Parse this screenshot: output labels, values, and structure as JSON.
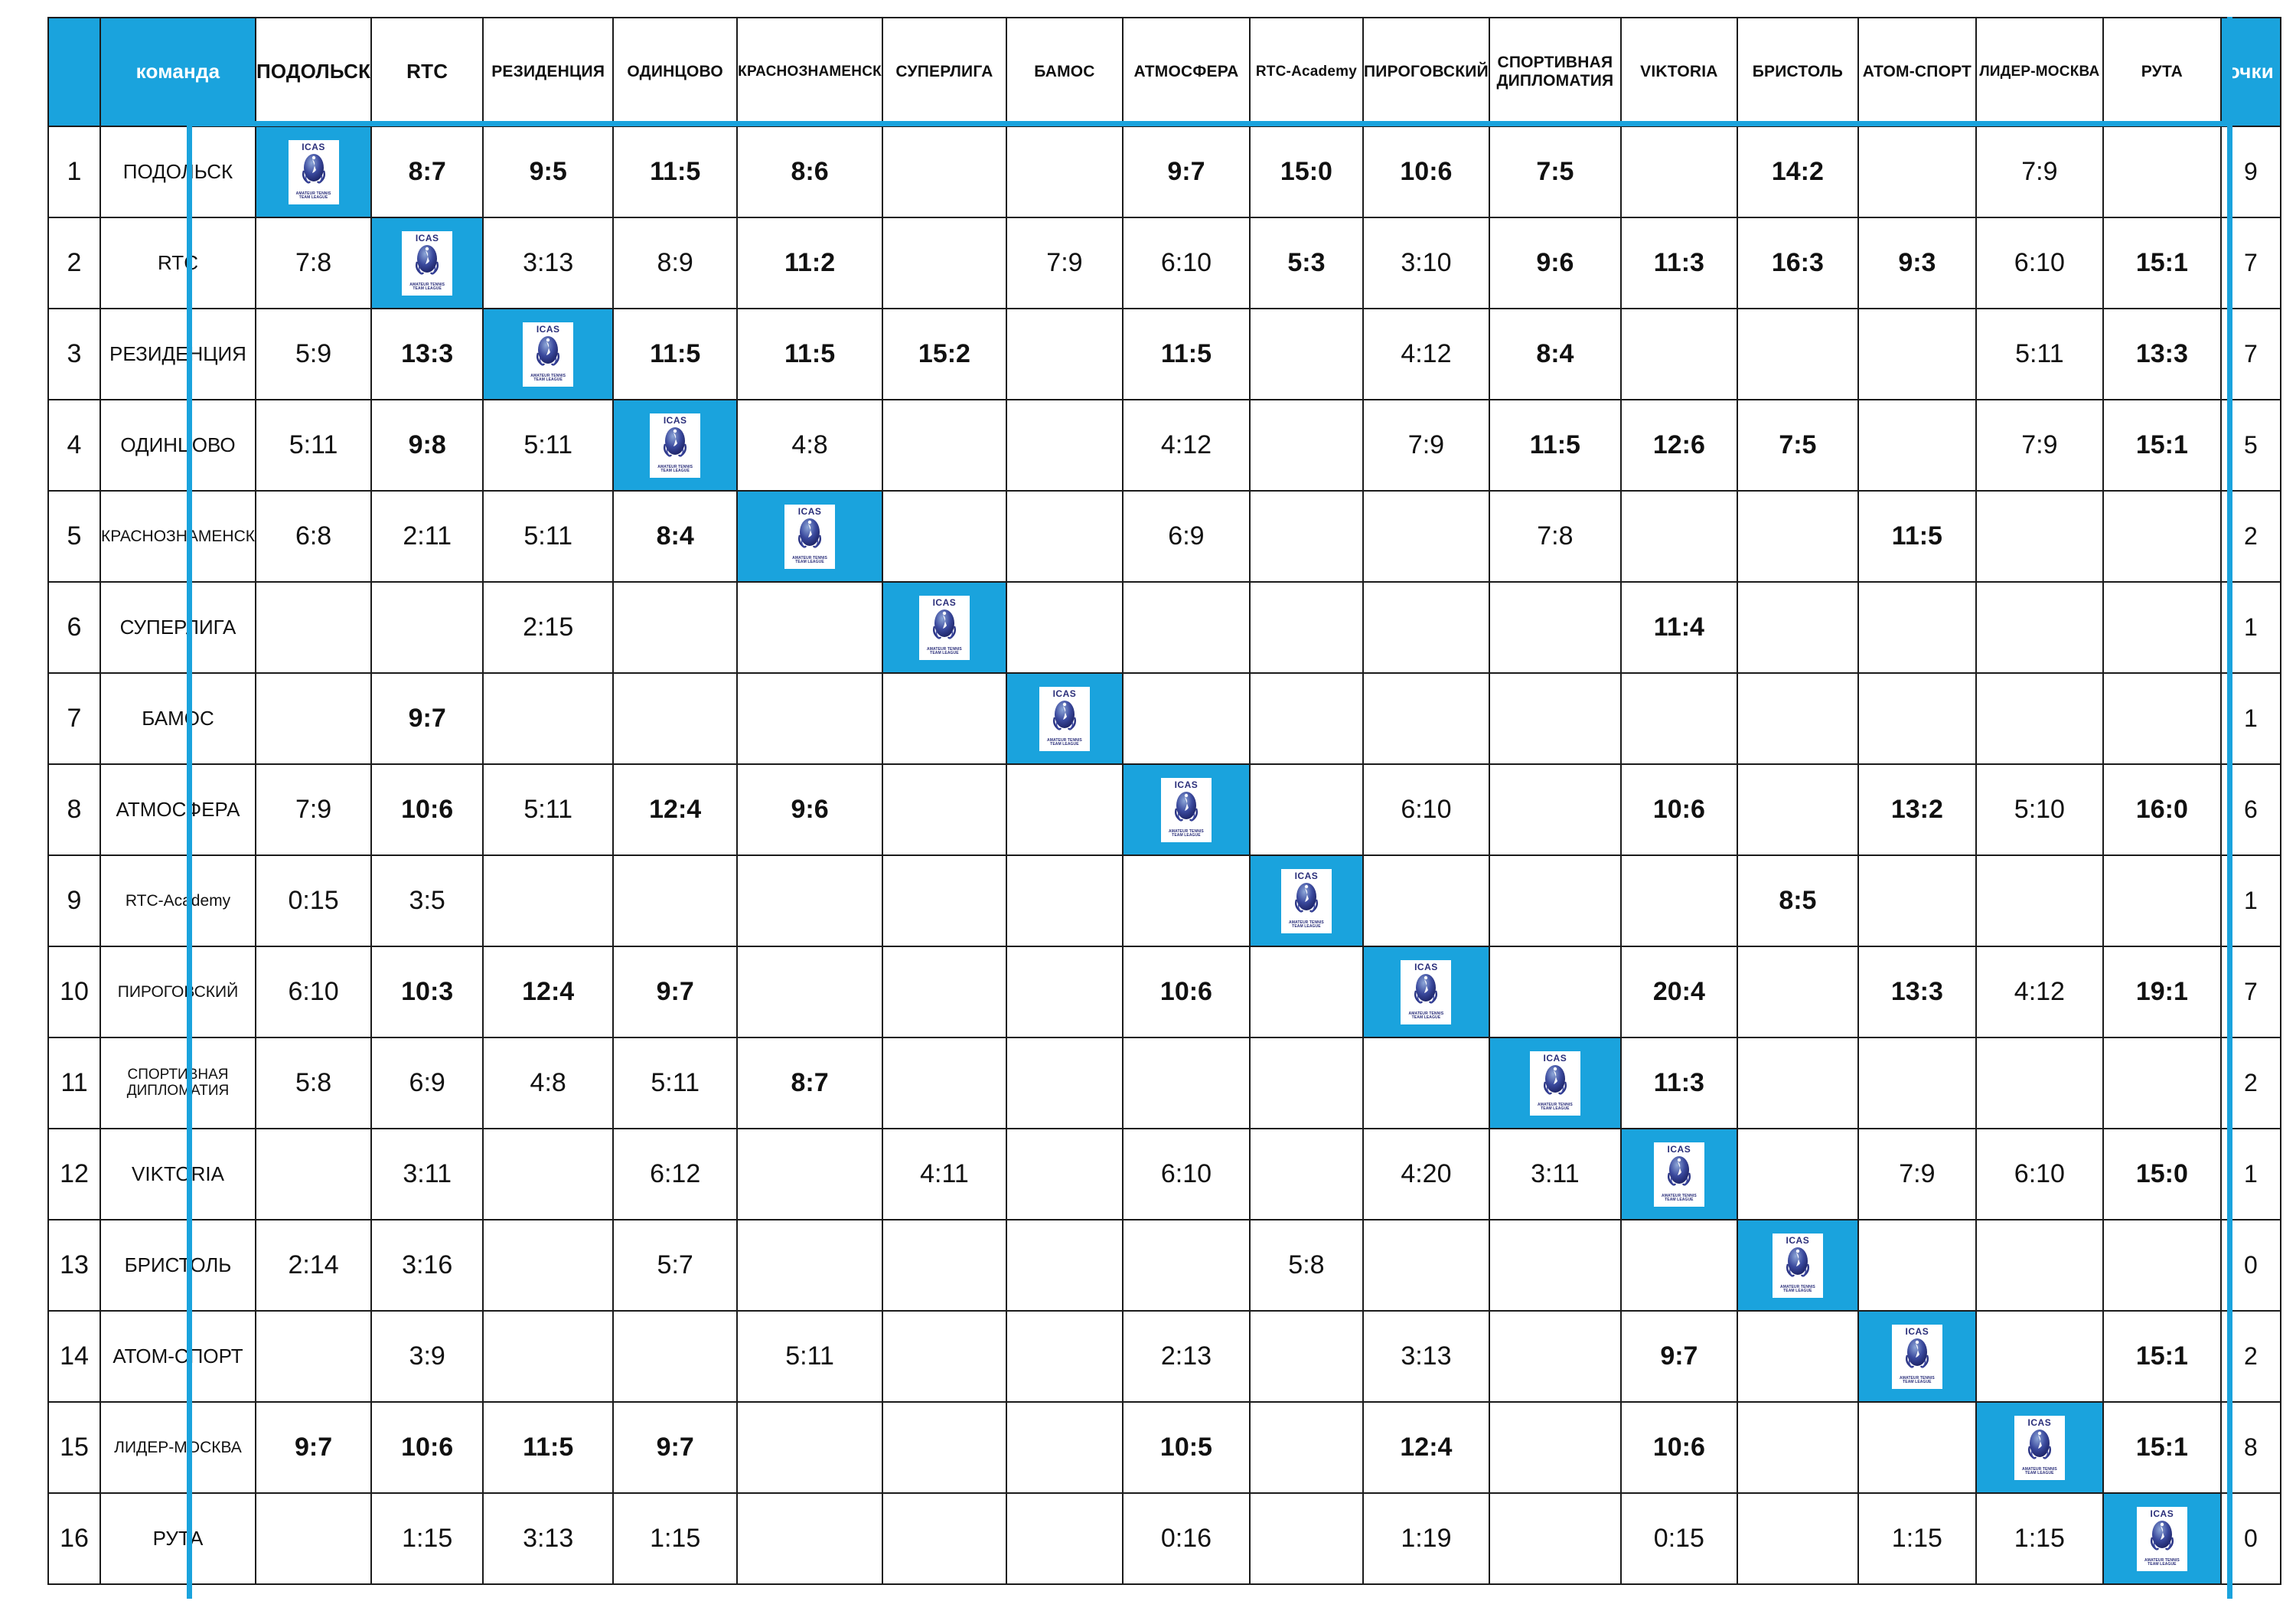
{
  "table": {
    "header": {
      "rank_label": "",
      "team_label": "команда",
      "points_label": "очки",
      "columns": [
        "ПОДОЛЬСК",
        "RTC",
        "РЕЗИДЕНЦИЯ",
        "ОДИНЦОВО",
        "КРАСНОЗНАМЕНСК",
        "СУПЕРЛИГА",
        "БАМОС",
        "АТМОСФЕРА",
        "RTC-Academy",
        "ПИРОГОВСКИЙ",
        "СПОРТИВНАЯ ДИПЛОМАТИЯ",
        "VIKTORIA",
        "БРИСТОЛЬ",
        "АТОМ-СПОРТ",
        "ЛИДЕР-МОСКВА",
        "РУТА"
      ]
    },
    "logo": {
      "top_text": "ICAS",
      "foot_line1": "AMATEUR TENNIS",
      "foot_line2": "TEAM LEAGUE"
    },
    "colors": {
      "accent": "#1aa3dd",
      "grid": "#1b1b1b",
      "text": "#111111"
    },
    "rows": [
      {
        "rank": "1",
        "team": "ПОДОЛЬСК",
        "points": "9",
        "cells": [
          "",
          "8:7",
          "9:5",
          "11:5",
          "8:6",
          "",
          "",
          "9:7",
          "15:0",
          "10:6",
          "7:5",
          "",
          "14:2",
          "",
          "7:9",
          ""
        ],
        "bold": [
          false,
          true,
          true,
          true,
          true,
          false,
          false,
          true,
          true,
          true,
          true,
          false,
          true,
          false,
          false,
          false
        ]
      },
      {
        "rank": "2",
        "team": "RTC",
        "points": "7",
        "cells": [
          "7:8",
          "",
          "3:13",
          "8:9",
          "11:2",
          "",
          "7:9",
          "6:10",
          "5:3",
          "3:10",
          "9:6",
          "11:3",
          "16:3",
          "9:3",
          "6:10",
          "15:1"
        ],
        "bold": [
          false,
          false,
          false,
          false,
          true,
          false,
          false,
          false,
          true,
          false,
          true,
          true,
          true,
          true,
          false,
          true
        ]
      },
      {
        "rank": "3",
        "team": "РЕЗИДЕНЦИЯ",
        "points": "7",
        "cells": [
          "5:9",
          "13:3",
          "",
          "11:5",
          "11:5",
          "15:2",
          "",
          "11:5",
          "",
          "4:12",
          "8:4",
          "",
          "",
          "",
          "5:11",
          "13:3"
        ],
        "bold": [
          false,
          true,
          false,
          true,
          true,
          true,
          false,
          true,
          false,
          false,
          true,
          false,
          false,
          false,
          false,
          true
        ]
      },
      {
        "rank": "4",
        "team": "ОДИНЦОВО",
        "points": "5",
        "cells": [
          "5:11",
          "9:8",
          "5:11",
          "",
          "4:8",
          "",
          "",
          "4:12",
          "",
          "7:9",
          "11:5",
          "12:6",
          "7:5",
          "",
          "7:9",
          "15:1"
        ],
        "bold": [
          false,
          true,
          false,
          false,
          false,
          false,
          false,
          false,
          false,
          false,
          true,
          true,
          true,
          false,
          false,
          true
        ]
      },
      {
        "rank": "5",
        "team": "КРАСНОЗНАМЕНСК",
        "points": "2",
        "cells": [
          "6:8",
          "2:11",
          "5:11",
          "8:4",
          "",
          "",
          "",
          "6:9",
          "",
          "",
          "7:8",
          "",
          "",
          "11:5",
          "",
          ""
        ],
        "bold": [
          false,
          false,
          false,
          true,
          false,
          false,
          false,
          false,
          false,
          false,
          false,
          false,
          false,
          true,
          false,
          false
        ]
      },
      {
        "rank": "6",
        "team": "СУПЕРЛИГА",
        "points": "1",
        "cells": [
          "",
          "",
          "2:15",
          "",
          "",
          "",
          "",
          "",
          "",
          "",
          "",
          "11:4",
          "",
          "",
          "",
          ""
        ],
        "bold": [
          false,
          false,
          false,
          false,
          false,
          false,
          false,
          false,
          false,
          false,
          false,
          true,
          false,
          false,
          false,
          false
        ]
      },
      {
        "rank": "7",
        "team": "БАМОС",
        "points": "1",
        "cells": [
          "",
          "9:7",
          "",
          "",
          "",
          "",
          "",
          "",
          "",
          "",
          "",
          "",
          "",
          "",
          "",
          ""
        ],
        "bold": [
          false,
          true,
          false,
          false,
          false,
          false,
          false,
          false,
          false,
          false,
          false,
          false,
          false,
          false,
          false,
          false
        ]
      },
      {
        "rank": "8",
        "team": "АТМОСФЕРА",
        "points": "6",
        "cells": [
          "7:9",
          "10:6",
          "5:11",
          "12:4",
          "9:6",
          "",
          "",
          "",
          "",
          "6:10",
          "",
          "10:6",
          "",
          "13:2",
          "5:10",
          "16:0"
        ],
        "bold": [
          false,
          true,
          false,
          true,
          true,
          false,
          false,
          false,
          false,
          false,
          false,
          true,
          false,
          true,
          false,
          true
        ]
      },
      {
        "rank": "9",
        "team": "RTC-Academy",
        "points": "1",
        "cells": [
          "0:15",
          "3:5",
          "",
          "",
          "",
          "",
          "",
          "",
          "",
          "",
          "",
          "",
          "8:5",
          "",
          "",
          ""
        ],
        "bold": [
          false,
          false,
          false,
          false,
          false,
          false,
          false,
          false,
          false,
          false,
          false,
          false,
          true,
          false,
          false,
          false
        ]
      },
      {
        "rank": "10",
        "team": "ПИРОГОВСКИЙ",
        "points": "7",
        "cells": [
          "6:10",
          "10:3",
          "12:4",
          "9:7",
          "",
          "",
          "",
          "10:6",
          "",
          "",
          "",
          "20:4",
          "",
          "13:3",
          "4:12",
          "19:1"
        ],
        "bold": [
          false,
          true,
          true,
          true,
          false,
          false,
          false,
          true,
          false,
          false,
          false,
          true,
          false,
          true,
          false,
          true
        ]
      },
      {
        "rank": "11",
        "team": "СПОРТИВНАЯ ДИПЛОМАТИЯ",
        "points": "2",
        "cells": [
          "5:8",
          "6:9",
          "4:8",
          "5:11",
          "8:7",
          "",
          "",
          "",
          "",
          "",
          "",
          "11:3",
          "",
          "",
          "",
          ""
        ],
        "bold": [
          false,
          false,
          false,
          false,
          true,
          false,
          false,
          false,
          false,
          false,
          false,
          true,
          false,
          false,
          false,
          false
        ]
      },
      {
        "rank": "12",
        "team": "VIKTORIA",
        "points": "1",
        "cells": [
          "",
          "3:11",
          "",
          "6:12",
          "",
          "4:11",
          "",
          "6:10",
          "",
          "4:20",
          "3:11",
          "",
          "",
          "7:9",
          "6:10",
          "15:0"
        ],
        "bold": [
          false,
          false,
          false,
          false,
          false,
          false,
          false,
          false,
          false,
          false,
          false,
          false,
          false,
          false,
          false,
          true
        ]
      },
      {
        "rank": "13",
        "team": "БРИСТОЛЬ",
        "points": "0",
        "cells": [
          "2:14",
          "3:16",
          "",
          "5:7",
          "",
          "",
          "",
          "",
          "5:8",
          "",
          "",
          "",
          "",
          "",
          "",
          ""
        ],
        "bold": [
          false,
          false,
          false,
          false,
          false,
          false,
          false,
          false,
          false,
          false,
          false,
          false,
          false,
          false,
          false,
          false
        ]
      },
      {
        "rank": "14",
        "team": "АТОМ-СПОРТ",
        "points": "2",
        "cells": [
          "",
          "3:9",
          "",
          "",
          "5:11",
          "",
          "",
          "2:13",
          "",
          "3:13",
          "",
          "9:7",
          "",
          "",
          "",
          "15:1"
        ],
        "bold": [
          false,
          false,
          false,
          false,
          false,
          false,
          false,
          false,
          false,
          false,
          false,
          true,
          false,
          false,
          false,
          true
        ]
      },
      {
        "rank": "15",
        "team": "ЛИДЕР-МОСКВА",
        "points": "8",
        "cells": [
          "9:7",
          "10:6",
          "11:5",
          "9:7",
          "",
          "",
          "",
          "10:5",
          "",
          "12:4",
          "",
          "10:6",
          "",
          "",
          "",
          "15:1"
        ],
        "bold": [
          true,
          true,
          true,
          true,
          false,
          false,
          false,
          true,
          false,
          true,
          false,
          true,
          false,
          false,
          false,
          true
        ]
      },
      {
        "rank": "16",
        "team": "РУТА",
        "points": "0",
        "cells": [
          "",
          "1:15",
          "3:13",
          "1:15",
          "",
          "",
          "",
          "0:16",
          "",
          "1:19",
          "",
          "0:15",
          "",
          "1:15",
          "1:15",
          ""
        ],
        "bold": [
          false,
          false,
          false,
          false,
          false,
          false,
          false,
          false,
          false,
          false,
          false,
          false,
          false,
          false,
          false,
          false
        ]
      }
    ]
  }
}
